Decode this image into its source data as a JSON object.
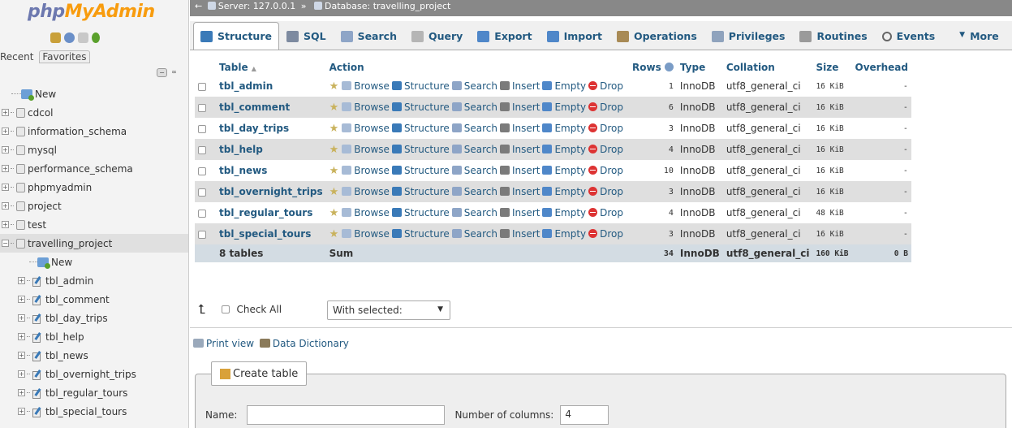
{
  "logo": {
    "part1": "php",
    "part2": "MyAdmin"
  },
  "nav": {
    "tab_recent": "Recent",
    "tab_favorites": "Favorites",
    "new_label": "New",
    "databases": [
      "cdcol",
      "information_schema",
      "mysql",
      "performance_schema",
      "phpmyadmin",
      "project",
      "test",
      "travelling_project"
    ],
    "sub_new": "New",
    "sub_tables": [
      "tbl_admin",
      "tbl_comment",
      "tbl_day_trips",
      "tbl_help",
      "tbl_news",
      "tbl_overnight_trips",
      "tbl_regular_tours",
      "tbl_special_tours"
    ]
  },
  "breadcrumb": {
    "server": "Server: 127.0.0.1",
    "sep": "»",
    "database": "Database: travelling_project"
  },
  "tabs": [
    "Structure",
    "SQL",
    "Search",
    "Query",
    "Export",
    "Import",
    "Operations",
    "Privileges",
    "Routines",
    "Events",
    "More"
  ],
  "table": {
    "headers": {
      "table": "Table",
      "sort": "▲",
      "action": "Action",
      "rows": "Rows",
      "type": "Type",
      "collation": "Collation",
      "size": "Size",
      "overhead": "Overhead"
    },
    "actions": {
      "browse": "Browse",
      "structure": "Structure",
      "search": "Search",
      "insert": "Insert",
      "empty": "Empty",
      "drop": "Drop"
    },
    "rows": [
      {
        "name": "tbl_admin",
        "rows": "1",
        "type": "InnoDB",
        "collation": "utf8_general_ci",
        "size": "16 KiB",
        "overhead": "-"
      },
      {
        "name": "tbl_comment",
        "rows": "6",
        "type": "InnoDB",
        "collation": "utf8_general_ci",
        "size": "16 KiB",
        "overhead": "-"
      },
      {
        "name": "tbl_day_trips",
        "rows": "3",
        "type": "InnoDB",
        "collation": "utf8_general_ci",
        "size": "16 KiB",
        "overhead": "-"
      },
      {
        "name": "tbl_help",
        "rows": "4",
        "type": "InnoDB",
        "collation": "utf8_general_ci",
        "size": "16 KiB",
        "overhead": "-"
      },
      {
        "name": "tbl_news",
        "rows": "10",
        "type": "InnoDB",
        "collation": "utf8_general_ci",
        "size": "16 KiB",
        "overhead": "-"
      },
      {
        "name": "tbl_overnight_trips",
        "rows": "3",
        "type": "InnoDB",
        "collation": "utf8_general_ci",
        "size": "16 KiB",
        "overhead": "-"
      },
      {
        "name": "tbl_regular_tours",
        "rows": "4",
        "type": "InnoDB",
        "collation": "utf8_general_ci",
        "size": "48 KiB",
        "overhead": "-"
      },
      {
        "name": "tbl_special_tours",
        "rows": "3",
        "type": "InnoDB",
        "collation": "utf8_general_ci",
        "size": "16 KiB",
        "overhead": "-"
      }
    ],
    "footer": {
      "count": "8 tables",
      "sum": "Sum",
      "rows": "34",
      "type": "InnoDB",
      "collation": "utf8_general_ci",
      "size": "160 KiB",
      "overhead": "0 B"
    }
  },
  "check_all": "Check All",
  "with_selected": "With selected:",
  "print_view": "Print view",
  "data_dictionary": "Data Dictionary",
  "create_table": {
    "legend": "Create table",
    "name_label": "Name:",
    "name_value": "",
    "columns_label": "Number of columns:",
    "columns_value": "4"
  },
  "colors": {
    "link": "#235a81",
    "logo_php": "#6c78af",
    "logo_myadmin": "#f89c0e",
    "row_alt": "#dfdfdf",
    "drop": "#dd3333"
  },
  "icons": [
    "home-icon",
    "docs-icon",
    "settings-icon",
    "reload-icon",
    "star-icon",
    "browse-icon",
    "structure-icon",
    "search-icon",
    "insert-icon",
    "empty-icon",
    "drop-icon",
    "help-icon"
  ]
}
